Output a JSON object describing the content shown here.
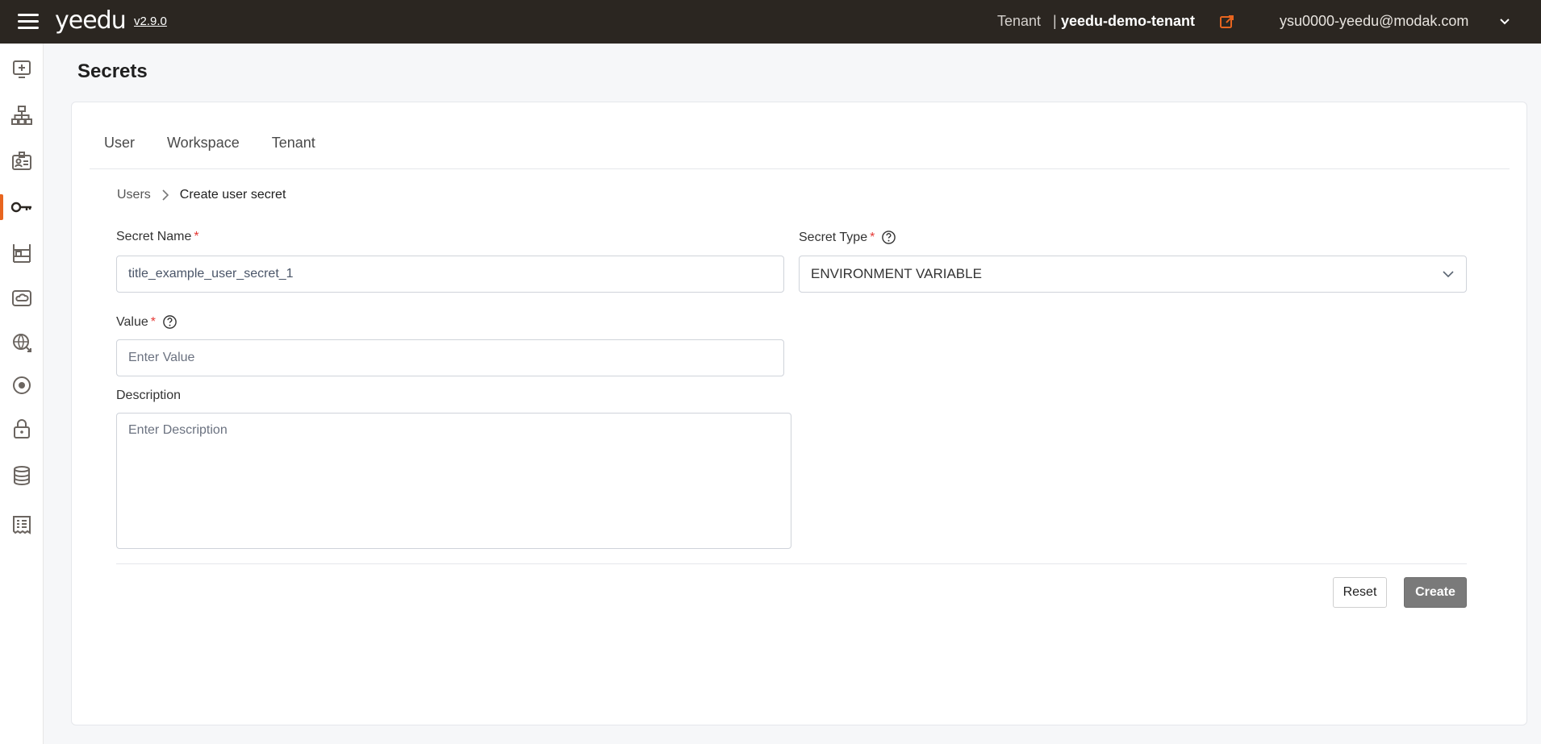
{
  "header": {
    "logo": "yeedu",
    "version": "v2.9.0",
    "tenant_label": "Tenant",
    "tenant_separator": "|",
    "tenant_name": "yeedu-demo-tenant",
    "user_email": "ysu0000-yeedu@modak.com",
    "accent_color": "#e8651f"
  },
  "sidebar": {
    "items": [
      {
        "icon": "add-screen-icon"
      },
      {
        "icon": "hierarchy-icon"
      },
      {
        "icon": "id-badge-icon"
      },
      {
        "icon": "key-icon",
        "active": true
      },
      {
        "icon": "shelves-icon"
      },
      {
        "icon": "cloud-drive-icon"
      },
      {
        "icon": "globe-network-icon"
      },
      {
        "icon": "target-icon"
      },
      {
        "icon": "lock-icon"
      },
      {
        "icon": "database-icon"
      },
      {
        "icon": "receipt-icon"
      }
    ]
  },
  "page": {
    "title": "Secrets"
  },
  "tabs": [
    "User",
    "Workspace",
    "Tenant"
  ],
  "breadcrumb": {
    "parent": "Users",
    "current": "Create user secret"
  },
  "form": {
    "secret_name_label": "Secret Name",
    "secret_name_value": "title_example_user_secret_1",
    "secret_type_label": "Secret Type",
    "secret_type_value": "ENVIRONMENT VARIABLE",
    "value_label": "Value",
    "value_placeholder": "Enter Value",
    "description_label": "Description",
    "description_placeholder": "Enter Description",
    "required_mark": "*"
  },
  "actions": {
    "reset_label": "Reset",
    "create_label": "Create"
  }
}
